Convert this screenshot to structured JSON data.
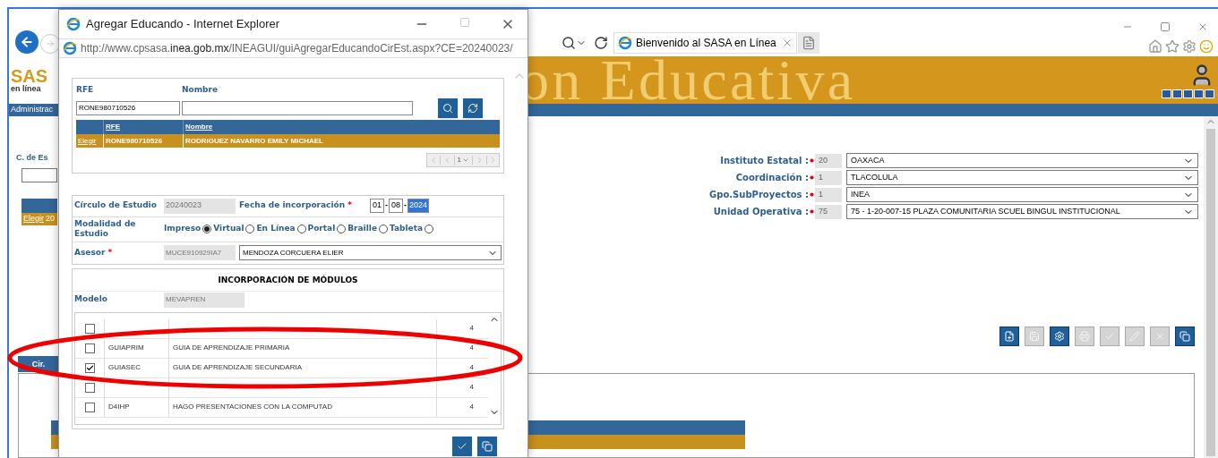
{
  "browser": {
    "tab_title": "Bienvenido al SASA en Línea",
    "banner_text": "on Educativa",
    "logo": {
      "name": "SAS",
      "tagline": "en línea"
    },
    "menu_item": "Administrac"
  },
  "background": {
    "left_label": "C. de Es",
    "grid_action": "Elegir",
    "grid_cell": "20",
    "tab": "Cir.",
    "fields": [
      {
        "label": "Instituto Estatal :",
        "code": "20",
        "value": "OAXACA"
      },
      {
        "label": "Coordinación :",
        "code": "1",
        "value": "TLACOLULA"
      },
      {
        "label": "Gpo.SubProyectos :",
        "code": "1",
        "value": "INEA"
      },
      {
        "label": "Unidad Operativa :",
        "code": "75",
        "value": "75 - 1-20-007-15 PLAZA COMUNITARIA SCUEL BINGUL INSTITUCIONAL"
      }
    ],
    "toolbar": [
      {
        "kind": "new",
        "disabled": false
      },
      {
        "kind": "save",
        "disabled": true
      },
      {
        "kind": "settings",
        "disabled": false
      },
      {
        "kind": "print",
        "disabled": true
      },
      {
        "kind": "check",
        "disabled": true
      },
      {
        "kind": "edit",
        "disabled": true
      },
      {
        "kind": "delete",
        "disabled": true
      },
      {
        "kind": "document",
        "disabled": false
      }
    ]
  },
  "popup": {
    "title": "Agregar Educando - Internet Explorer",
    "url": {
      "prefix": "http://www.cpsasa.",
      "domain": "inea.gob.mx",
      "path": "/INEAGUI/guiAgregarEducandoCirEst.aspx?CE=20240023/"
    },
    "search": {
      "rfe_label": "RFE",
      "rfe_value": "RONE980710526",
      "nombre_label": "Nombre"
    },
    "results": {
      "columns": [
        "RFE",
        "Nombre"
      ],
      "rows": [
        {
          "action": "Elegir",
          "rfe": "RONE980710526",
          "nombre": "RODRIGUEZ NAVARRO EMILY MICHAEL",
          "selected": true
        }
      ]
    },
    "pager": {
      "page": "1"
    },
    "circulo": {
      "label": "Círculo de Estudio",
      "value": "20240023"
    },
    "fecha": {
      "label": "Fecha de incorporación",
      "required_mark": "*",
      "day": "01",
      "separator": "-",
      "month": "08",
      "year": "2024"
    },
    "modalidad": {
      "label": "Modalidad de Estudio",
      "options": [
        {
          "label": "Impreso",
          "selected": true
        },
        {
          "label": "Virtual",
          "selected": false
        },
        {
          "label": "En Línea",
          "selected": false
        },
        {
          "label": "Portal",
          "selected": false
        },
        {
          "label": "Braille",
          "selected": false
        },
        {
          "label": "Tableta",
          "selected": false
        }
      ]
    },
    "asesor": {
      "label": "Asesor",
      "required_mark": "*",
      "code": "MUCE910929IA7",
      "value": "MENDOZA CORCUERA ELIER"
    },
    "modules": {
      "title": "INCORPORACIÓN DE MÓDULOS",
      "modelo_label": "Modelo",
      "modelo_value": "MEVAPREN",
      "rows": [
        {
          "units": "4",
          "checked": false
        },
        {
          "code": "GUIAPRIM",
          "description": "GUIA DE APRENDIZAJE PRIMARIA",
          "units": "4",
          "checked": false
        },
        {
          "code": "GUIASEC",
          "description": "GUIA DE APRENDIZAJE SECUNDARIA",
          "units": "4",
          "checked": true
        },
        {
          "units": "4",
          "checked": false
        },
        {
          "code": "D4IHP",
          "description": "HAGO PRESENTACIONES CON LA COMPUTAD",
          "units": "4",
          "checked": false
        }
      ]
    }
  }
}
